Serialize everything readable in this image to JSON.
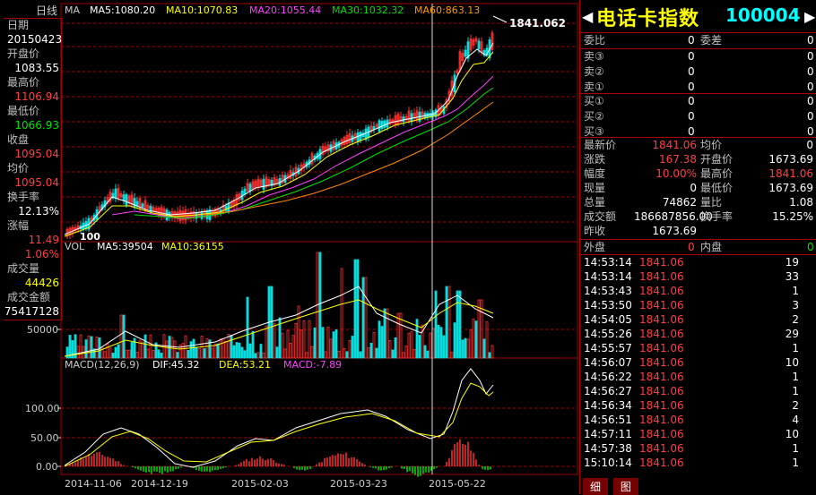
{
  "header": {
    "period_label": "日线",
    "ma_label": "MA",
    "ma5": "MA5:1080.20",
    "ma10": "MA10:1070.83",
    "ma20": "MA20:1055.44",
    "ma30": "MA30:1032.32",
    "ma60": "MA60:863.13"
  },
  "left_info": {
    "date_label": "日期",
    "date": "20150423",
    "open_label": "开盘价",
    "open": "1083.55",
    "high_label": "最高价",
    "high": "1106.94",
    "low_label": "最低价",
    "low": "1066.93",
    "close_label": "收盘",
    "close": "1095.04",
    "avg_label": "均价",
    "avg": "1095.04",
    "turnover_label": "换手率",
    "turnover": "12.13%",
    "change_label": "涨幅",
    "change": "11.49",
    "change_pct": "1.06%",
    "vol_label": "成交量",
    "vol": "44426",
    "amount_label": "成交金额",
    "amount": "75417128"
  },
  "chart_labels": {
    "peak": "1841.062",
    "low": "100",
    "vol_title": "VOL",
    "vol_ma5": "MA5:39504",
    "vol_ma10": "MA10:36155",
    "vol_axis": "50000",
    "macd_title": "MACD(12,26,9)",
    "dif": "DIF:45.32",
    "dea": "DEA:53.21",
    "macd": "MACD:-7.89",
    "macd_axis": [
      "100.00",
      "50.00",
      "0.00"
    ],
    "dates": [
      "2014-11-06",
      "2014-12-19",
      "2015-02-03",
      "2015-03-23",
      "2015-05-22"
    ]
  },
  "panel": {
    "name": "电话卡指数",
    "code": "100004",
    "weibi_label": "委比",
    "weibi": "0",
    "weicha_label": "委差",
    "weicha": "0",
    "sells": [
      {
        "label": "卖③",
        "price": "0",
        "vol": "0"
      },
      {
        "label": "卖②",
        "price": "0",
        "vol": "0"
      },
      {
        "label": "卖①",
        "price": "0",
        "vol": "0"
      }
    ],
    "buys": [
      {
        "label": "买①",
        "price": "0",
        "vol": "0"
      },
      {
        "label": "买②",
        "price": "0",
        "vol": "0"
      },
      {
        "label": "买③",
        "price": "0",
        "vol": "0"
      }
    ],
    "stats": [
      {
        "l1": "最新价",
        "v1": "1841.06",
        "c1": "red",
        "l2": "均价",
        "v2": "0",
        "c2": "wht"
      },
      {
        "l1": "涨跌",
        "v1": "167.38",
        "c1": "red",
        "l2": "开盘价",
        "v2": "1673.69",
        "c2": "wht"
      },
      {
        "l1": "幅度",
        "v1": "10.00%",
        "c1": "red",
        "l2": "最高价",
        "v2": "1841.06",
        "c2": "red"
      },
      {
        "l1": "现量",
        "v1": "0",
        "c1": "wht",
        "l2": "最低价",
        "v2": "1673.69",
        "c2": "wht"
      },
      {
        "l1": "总量",
        "v1": "74862",
        "c1": "wht",
        "l2": "量比",
        "v2": "1.08",
        "c2": "wht"
      },
      {
        "l1": "成交额",
        "v1": "186687856.00",
        "c1": "wht",
        "l2": "换手率",
        "v2": "15.25%",
        "c2": "wht"
      },
      {
        "l1": "昨收",
        "v1": "1673.69",
        "c1": "wht",
        "l2": "",
        "v2": "",
        "c2": "wht"
      }
    ],
    "waipan_label": "外盘",
    "waipan": "0",
    "neipan_label": "内盘",
    "neipan": "0",
    "ticks": [
      {
        "t": "14:53:14",
        "p": "1841.06",
        "v": "19"
      },
      {
        "t": "14:53:14",
        "p": "1841.06",
        "v": "33"
      },
      {
        "t": "14:53:43",
        "p": "1841.06",
        "v": "1"
      },
      {
        "t": "14:53:50",
        "p": "1841.06",
        "v": "3"
      },
      {
        "t": "14:54:05",
        "p": "1841.06",
        "v": "2"
      },
      {
        "t": "14:55:26",
        "p": "1841.06",
        "v": "29"
      },
      {
        "t": "14:55:57",
        "p": "1841.06",
        "v": "1"
      },
      {
        "t": "14:56:07",
        "p": "1841.06",
        "v": "10"
      },
      {
        "t": "14:56:22",
        "p": "1841.06",
        "v": "1"
      },
      {
        "t": "14:56:27",
        "p": "1841.06",
        "v": "1"
      },
      {
        "t": "14:56:34",
        "p": "1841.06",
        "v": "2"
      },
      {
        "t": "14:56:51",
        "p": "1841.06",
        "v": "4"
      },
      {
        "t": "14:57:11",
        "p": "1841.06",
        "v": "10"
      },
      {
        "t": "14:57:38",
        "p": "1841.06",
        "v": "1"
      },
      {
        "t": "15:10:14",
        "p": "1841.06",
        "v": "1"
      }
    ],
    "tab1": "细",
    "tab2": "图"
  },
  "colors": {
    "up": "#ff3030",
    "down": "#00e0e0",
    "ma5": "#ffffff",
    "ma10": "#ffff00",
    "ma20": "#ff40ff",
    "ma30": "#00e000",
    "ma60": "#ff8800",
    "grid": "#a00000"
  }
}
